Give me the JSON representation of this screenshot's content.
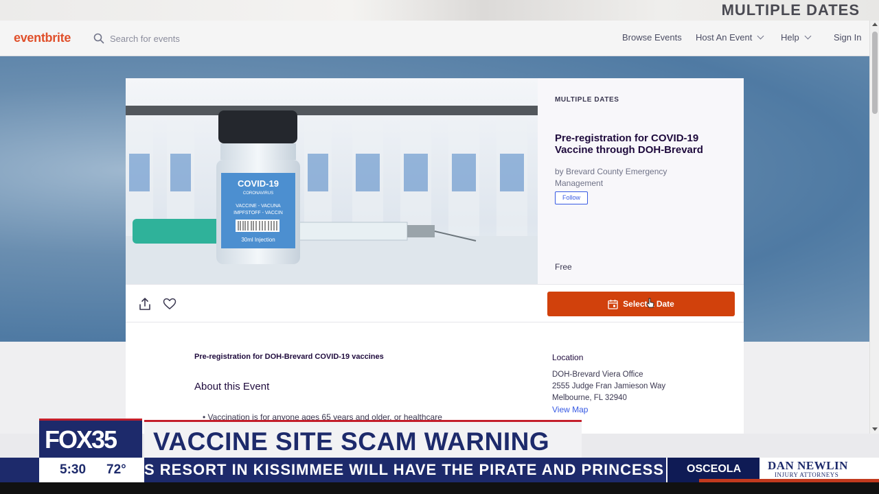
{
  "top_strip": {
    "text": "MULTIPLE DATES"
  },
  "nav": {
    "logo": "eventbrite",
    "search_placeholder": "Search for events",
    "browse": "Browse Events",
    "host": "Host An Event",
    "help": "Help",
    "signin": "Sign In"
  },
  "event": {
    "dates_label": "MULTIPLE DATES",
    "title": "Pre-registration for COVID-19 Vaccine through DOH-Brevard",
    "organizer": "by Brevard County Emergency Management",
    "follow": "Follow",
    "price": "Free",
    "select_date": "Select a Date",
    "image_label": {
      "title": "COVID-19",
      "sub": "CORONAVIRUS",
      "line1": "VACCINE - VACUNA",
      "line2": "IMPFSTOFF - VACCIN",
      "dose": "30ml Injection"
    }
  },
  "details": {
    "summary": "Pre-registration for DOH-Brevard COVID-19 vaccines",
    "about_heading": "About this Event",
    "bullet": "Vaccination is for anyone ages 65 years and older, or healthcare",
    "location_heading": "Location",
    "location_lines": [
      "DOH-Brevard Viera Office",
      "2555 Judge Fran Jamieson Way",
      "Melbourne, FL 32940"
    ],
    "view_map": "View Map"
  },
  "news": {
    "station": "FOX35",
    "headline": "VACCINE SITE SCAM WARNING",
    "time": "5:30",
    "temperature": "72°",
    "ticker": "S RESORT IN KISSIMMEE WILL HAVE THE PIRATE AND PRINCESS TAKE",
    "location_tag": "OSCEOLA",
    "sponsor_name": "DAN NEWLIN",
    "sponsor_sub": "INJURY ATTORNEYS"
  },
  "colors": {
    "brand": "#d1410c",
    "link": "#3659e3",
    "fox_navy": "#1d2a6b",
    "fox_red": "#c41e2a"
  }
}
